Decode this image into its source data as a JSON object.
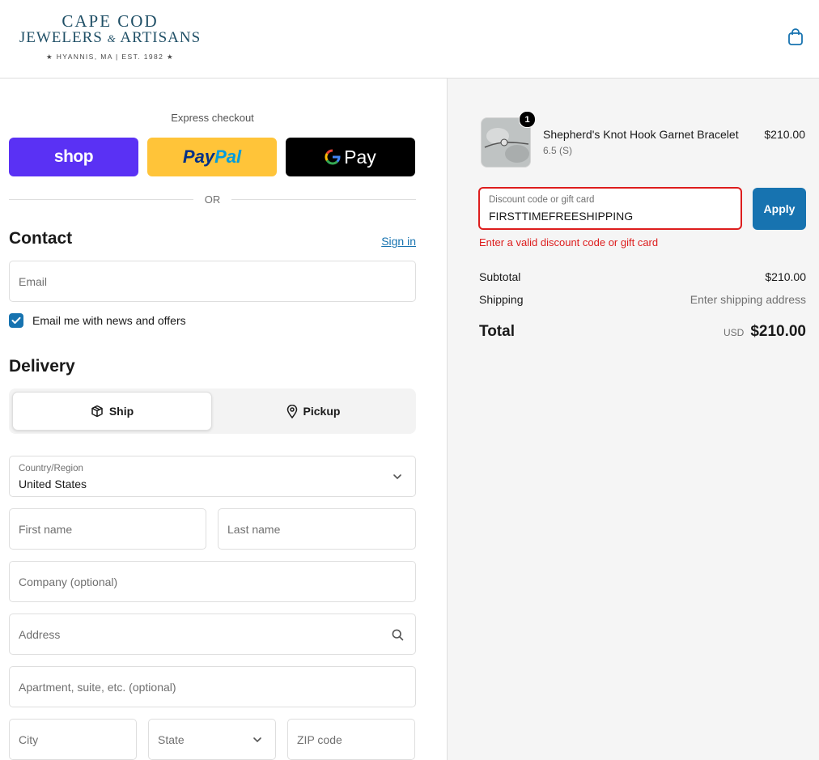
{
  "brand": {
    "line1": "CAPE COD",
    "line2a": "JEWELERS",
    "amp": "&",
    "line2b": "ARTISANS",
    "tagline": "★ HYANNIS, MA | EST. 1982 ★"
  },
  "header": {
    "cart_icon": "shopping-bag-icon"
  },
  "express": {
    "label": "Express checkout",
    "shop_label": "shop",
    "paypal_pay": "Pay",
    "paypal_pal": "Pal",
    "gpay_label": "Pay",
    "divider_text": "OR"
  },
  "contact": {
    "title": "Contact",
    "sign_in": "Sign in",
    "email_placeholder": "Email",
    "newsletter_label": "Email me with news and offers",
    "newsletter_checked": true
  },
  "delivery": {
    "title": "Delivery",
    "ship_label": "Ship",
    "pickup_label": "Pickup",
    "selected": "Ship",
    "country_label": "Country/Region",
    "country_value": "United States",
    "first_name_placeholder": "First name",
    "last_name_placeholder": "Last name",
    "company_placeholder": "Company (optional)",
    "address_placeholder": "Address",
    "apartment_placeholder": "Apartment, suite, etc. (optional)",
    "city_placeholder": "City",
    "state_placeholder": "State",
    "zip_placeholder": "ZIP code"
  },
  "order": {
    "item": {
      "name": "Shepherd's Knot Hook Garnet Bracelet",
      "variant": "6.5 (S)",
      "price": "$210.00",
      "quantity": "1"
    },
    "discount": {
      "label": "Discount code or gift card",
      "value": "FIRSTTIMEFREESHIPPING",
      "apply_label": "Apply",
      "error": "Enter a valid discount code or gift card"
    },
    "subtotal_label": "Subtotal",
    "subtotal_value": "$210.00",
    "shipping_label": "Shipping",
    "shipping_value": "Enter shipping address",
    "total_label": "Total",
    "total_currency": "USD",
    "total_value": "$210.00"
  },
  "colors": {
    "accent": "#1773b0",
    "error": "#dd1d1d",
    "shop": "#5a31f4",
    "paypal": "#ffc439",
    "gpay": "#000000"
  }
}
